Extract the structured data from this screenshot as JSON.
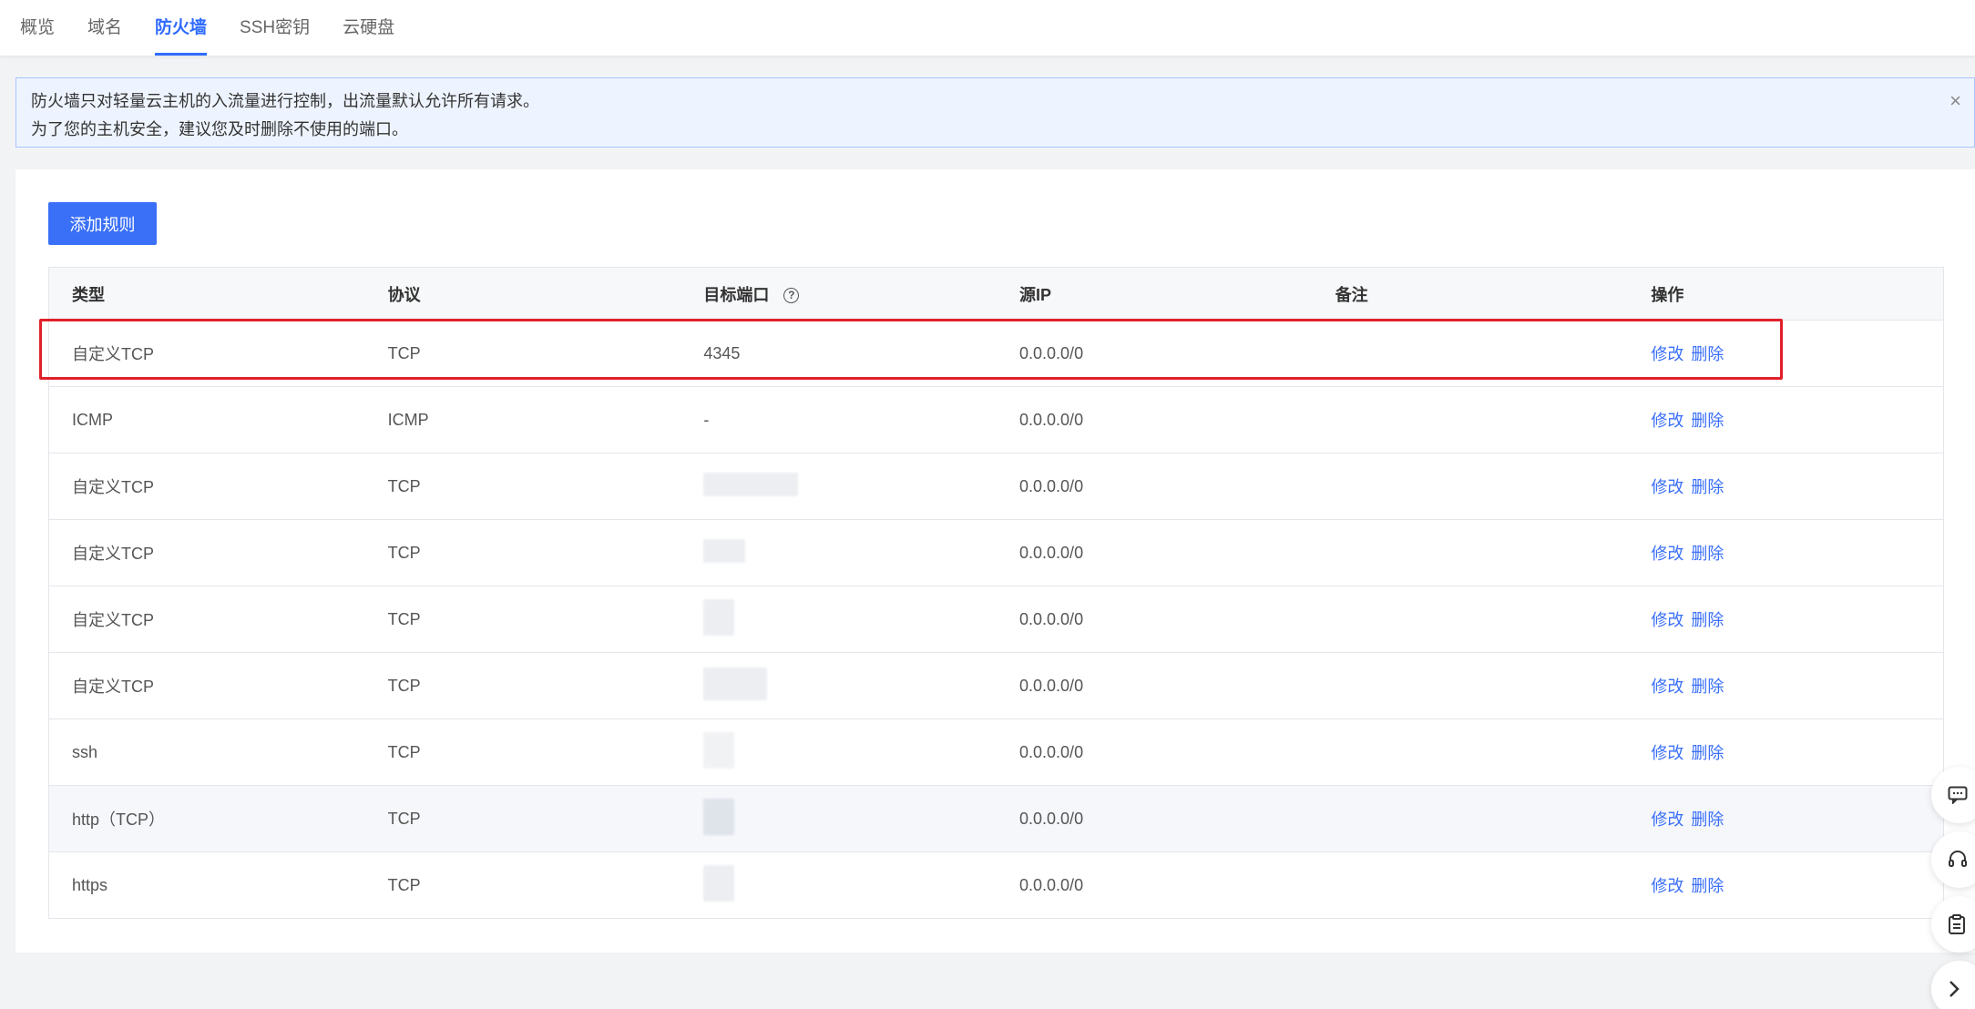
{
  "tabs": [
    {
      "label": "概览",
      "active": false
    },
    {
      "label": "域名",
      "active": false
    },
    {
      "label": "防火墙",
      "active": true
    },
    {
      "label": "SSH密钥",
      "active": false
    },
    {
      "label": "云硬盘",
      "active": false
    }
  ],
  "notice": {
    "line1": "防火墙只对轻量云主机的入流量进行控制，出流量默认允许所有请求。",
    "line2": "为了您的主机安全，建议您及时删除不使用的端口。",
    "close_icon": "×"
  },
  "toolbar": {
    "add_rule_label": "添加规则"
  },
  "table": {
    "headers": [
      "类型",
      "协议",
      "目标端口",
      "源IP",
      "备注",
      "操作"
    ],
    "help_icon": "?",
    "actions": {
      "edit": "修改",
      "delete": "删除"
    },
    "rows": [
      {
        "type": "自定义TCP",
        "protocol": "TCP",
        "port": "4345",
        "source_ip": "0.0.0.0/0",
        "note": ""
      },
      {
        "type": "ICMP",
        "protocol": "ICMP",
        "port": "-",
        "source_ip": "0.0.0.0/0",
        "note": ""
      },
      {
        "type": "自定义TCP",
        "protocol": "TCP",
        "port": "",
        "source_ip": "0.0.0.0/0",
        "note": ""
      },
      {
        "type": "自定义TCP",
        "protocol": "TCP",
        "port": "",
        "source_ip": "0.0.0.0/0",
        "note": ""
      },
      {
        "type": "自定义TCP",
        "protocol": "TCP",
        "port": "",
        "source_ip": "0.0.0.0/0",
        "note": ""
      },
      {
        "type": "自定义TCP",
        "protocol": "TCP",
        "port": "",
        "source_ip": "0.0.0.0/0",
        "note": ""
      },
      {
        "type": "ssh",
        "protocol": "TCP",
        "port": "",
        "source_ip": "0.0.0.0/0",
        "note": ""
      },
      {
        "type": "http（TCP）",
        "protocol": "TCP",
        "port": "",
        "source_ip": "0.0.0.0/0",
        "note": ""
      },
      {
        "type": "https",
        "protocol": "TCP",
        "port": "",
        "source_ip": "0.0.0.0/0",
        "note": ""
      }
    ]
  },
  "colors": {
    "accent": "#3a6ff8",
    "highlight": "#e0202a"
  },
  "float_tools": [
    "chat-icon",
    "headset-icon",
    "clipboard-icon",
    "chevron-right-icon"
  ]
}
